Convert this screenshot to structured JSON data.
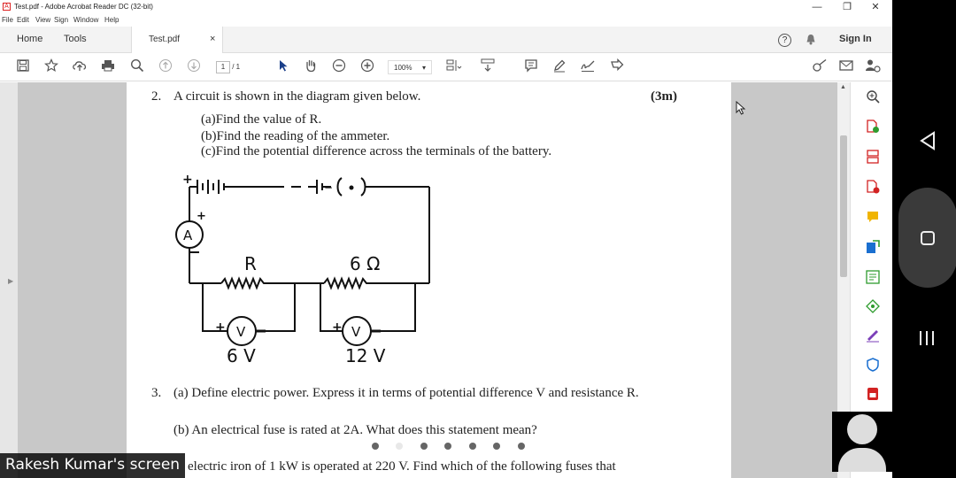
{
  "window": {
    "title": "Test.pdf - Adobe Acrobat Reader DC (32-bit)",
    "minimize": "—",
    "restore": "❐",
    "close": "✕"
  },
  "menu": [
    "File",
    "Edit",
    "View",
    "Sign",
    "Window",
    "Help"
  ],
  "tabs": {
    "home": "Home",
    "tools": "Tools",
    "document": "Test.pdf",
    "close": "×",
    "help": "?",
    "sign_in": "Sign In"
  },
  "toolbar": {
    "page_current": "1",
    "page_total": "/ 1",
    "zoom": "100%",
    "zoom_caret": "▾"
  },
  "document": {
    "q2_number": "2.",
    "q2_text": "A circuit is shown in the diagram given below.",
    "q2_marks": "(3m)",
    "q2_a": "(a)Find the value of R.",
    "q2_b": "(b)Find the reading of the ammeter.",
    "q2_c": "(c)Find the potential difference across the terminals of the battery.",
    "circuit": {
      "ammeter": "A",
      "resistor_r": "R",
      "resistor_6": "6 Ω",
      "voltmeter": "V",
      "reading_1": "6 V",
      "reading_2": "12 V",
      "plus": "+",
      "minus": "−"
    },
    "q3_number": "3.",
    "q3_a": "(a) Define electric power. Express it in terms of potential difference V and resistance R.",
    "q3_b": "(b) An electrical fuse is rated at 2A. What does this statement mean?",
    "q3_c_partial": "electric iron of 1 kW is operated at 220 V. Find which of the following fuses that"
  },
  "overlay": {
    "screen_label": "Rakesh Kumar's screen"
  },
  "colors": {
    "acrobat_red": "#d22222",
    "tool_blue": "#1a6fd0",
    "tool_green": "#2e9c2e",
    "tool_yellow": "#f0b400"
  }
}
